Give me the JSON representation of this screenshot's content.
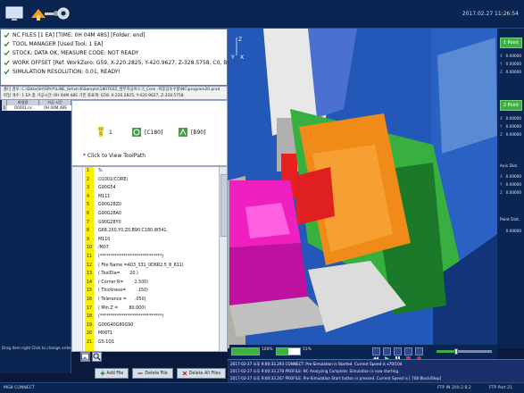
{
  "app": {
    "name": "MGB CONNECT",
    "datetime": "2017.02.27 11:26:54"
  },
  "status": {
    "nc_files": "NC FILES [1 EA] [TIME: 0H 04M 48S] [Folder: end]",
    "tool_manager": "TOOL MANAGER   [Used Tool: 1 EA]",
    "stock": "STOCK: DATA OK, MEASURE CODE: NOT READY",
    "work_offset": "WORK OFFSET [Ref. WorkZero: G59, X-220.2825, Y-420.9627, Z-328.5758, C0, B0]",
    "simulation": "SIMULATION RESOLUTION: 0.01, READY!"
  },
  "pathbar": {
    "line1": "폴더 경로: C:\\Data\\SH\\SPHY\\LINE_SH\\vtrill\\Sample\\180702Z_절무차공아스크_Core -피동맘조수항\\NC\\program20.prxd",
    "line2": "파일 개수: 1 EA    총 가공시간: 0H 04M 48S    기준 좌표계: G59, X-220.2825, Y-420.9627, Z-328.5758"
  },
  "files": {
    "headers": [
      "파일명",
      "가공 시간"
    ],
    "rows": [
      {
        "index": "1",
        "name": "O0001.nc",
        "time": "0H 04M 48S"
      }
    ]
  },
  "drag_note": "Drag item right Click to change order.",
  "tools": [
    {
      "label": "1"
    },
    {
      "label": "[C180]"
    },
    {
      "label": "[B90]"
    }
  ],
  "view_toolpath": "* Click to View ToolPath",
  "code": {
    "lines": [
      {
        "n": "1",
        "t": "%"
      },
      {
        "n": "2",
        "t": "O1001(CORE)"
      },
      {
        "n": "3",
        "t": "G90G54"
      },
      {
        "n": "4",
        "t": "M111"
      },
      {
        "n": "5",
        "t": "G90G28Z0"
      },
      {
        "n": "6",
        "t": "G90G28A0"
      },
      {
        "n": "7",
        "t": "G90G28Y0"
      },
      {
        "n": "8",
        "t": "G68.2X0.Y0.Z0.B90.C180.W541."
      },
      {
        "n": "9",
        "t": "M110"
      },
      {
        "n": "10",
        "t": "/M07"
      },
      {
        "n": "11",
        "t": "(*****************************)"
      },
      {
        "n": "12",
        "t": "( File Name =A03_331_0D6R2.5_8_611)"
      },
      {
        "n": "13",
        "t": "( ToolDia=       20.)"
      },
      {
        "n": "14",
        "t": "( Corner R=        2.500)"
      },
      {
        "n": "15",
        "t": "( Thickness=        .150)"
      },
      {
        "n": "16",
        "t": "( Tolerance =      .050)"
      },
      {
        "n": "17",
        "t": "( Min Z =        80.000)"
      },
      {
        "n": "18",
        "t": "(*****************************)"
      },
      {
        "n": "19",
        "t": "G00G40G80G90"
      },
      {
        "n": "20",
        "t": "M06T1"
      },
      {
        "n": "21",
        "t": "G5.1Q1"
      }
    ]
  },
  "buttons": {
    "add": "Add File",
    "delete": "Delete File",
    "delete_all": "Delete All Files"
  },
  "right": {
    "point1": "1 Point",
    "point2": "2 Point",
    "axis_dist": "Axis Dist.",
    "point_dist": "Point Dist.",
    "axes": [
      "X",
      "Y",
      "Z"
    ],
    "point1_values": [
      "0.00000",
      "0.00000",
      "0.00000"
    ],
    "point2_values": [
      "0.00000",
      "0.00000",
      "0.00000"
    ],
    "axis_values": [
      "0.00000",
      "0.00000",
      "0.00000"
    ],
    "point_dist_value": "0.00000"
  },
  "sim": {
    "speed1": "100%",
    "speed2": "51%",
    "progress_fraction": 0.35
  },
  "logs": [
    "2017-02-27 오후 9:00:33.293 CONNECT: Pre-Simulation is Started. Current Speed is x70/104",
    "2017-02-27 오후 9:00:33.278 PROFILE: NC Analyzing Complete. Simulation is now starting.",
    "2017-02-27 오후 9:00:33.267 PROFILE: Pre-Simulation Start button is pressed. Current Speed is [ 708 Block/Step]"
  ],
  "statusbar": {
    "left": "MGB CONNECT",
    "ftp1": "FTP IN 200.2.8.2",
    "ftp2": "FTP Port 21"
  }
}
